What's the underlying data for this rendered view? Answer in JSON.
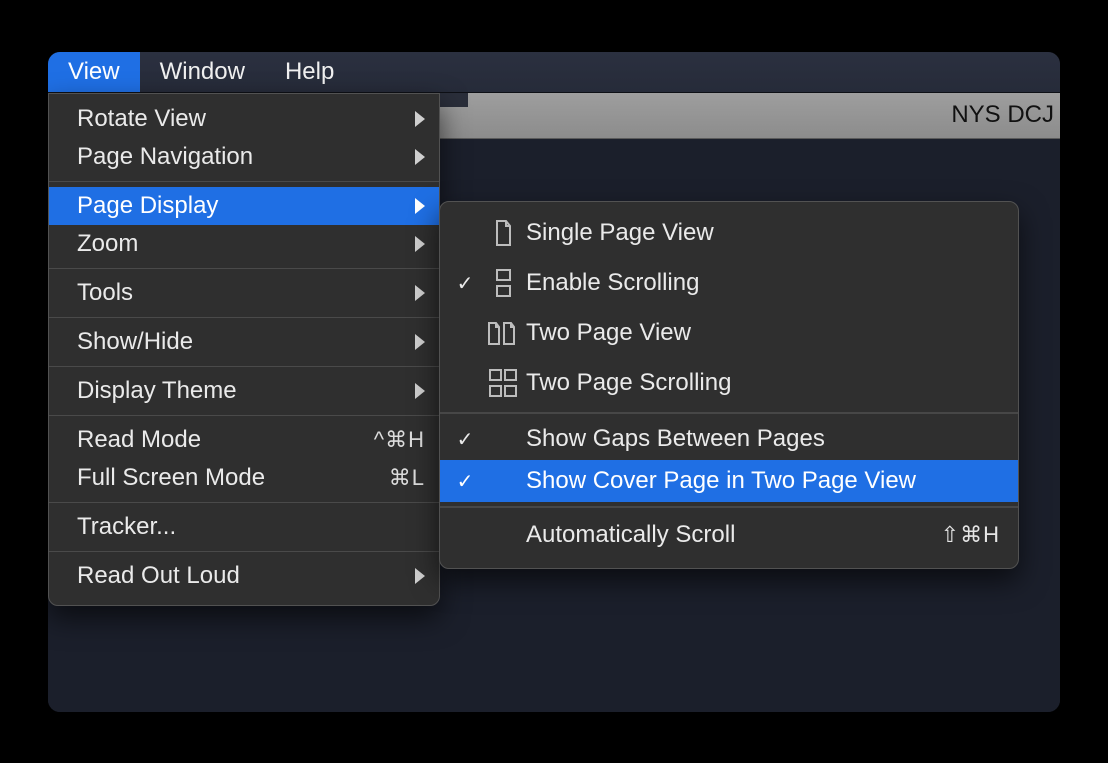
{
  "menubar": {
    "view": "View",
    "window": "Window",
    "help": "Help"
  },
  "window_title": "NYS DCJ",
  "view_menu": {
    "rotate_view": "Rotate View",
    "page_navigation": "Page Navigation",
    "page_display": "Page Display",
    "zoom": "Zoom",
    "tools": "Tools",
    "show_hide": "Show/Hide",
    "display_theme": "Display Theme",
    "read_mode": "Read Mode",
    "read_mode_shortcut": "^⌘H",
    "full_screen_mode": "Full Screen Mode",
    "full_screen_shortcut": "⌘L",
    "tracker": "Tracker...",
    "read_out_loud": "Read Out Loud"
  },
  "page_display_submenu": {
    "single_page_view": "Single Page View",
    "enable_scrolling": "Enable Scrolling",
    "two_page_view": "Two Page View",
    "two_page_scrolling": "Two Page Scrolling",
    "show_gaps": "Show Gaps Between Pages",
    "show_cover": "Show Cover Page in Two Page View",
    "auto_scroll": "Automatically Scroll",
    "auto_scroll_shortcut": "⇧⌘H"
  }
}
